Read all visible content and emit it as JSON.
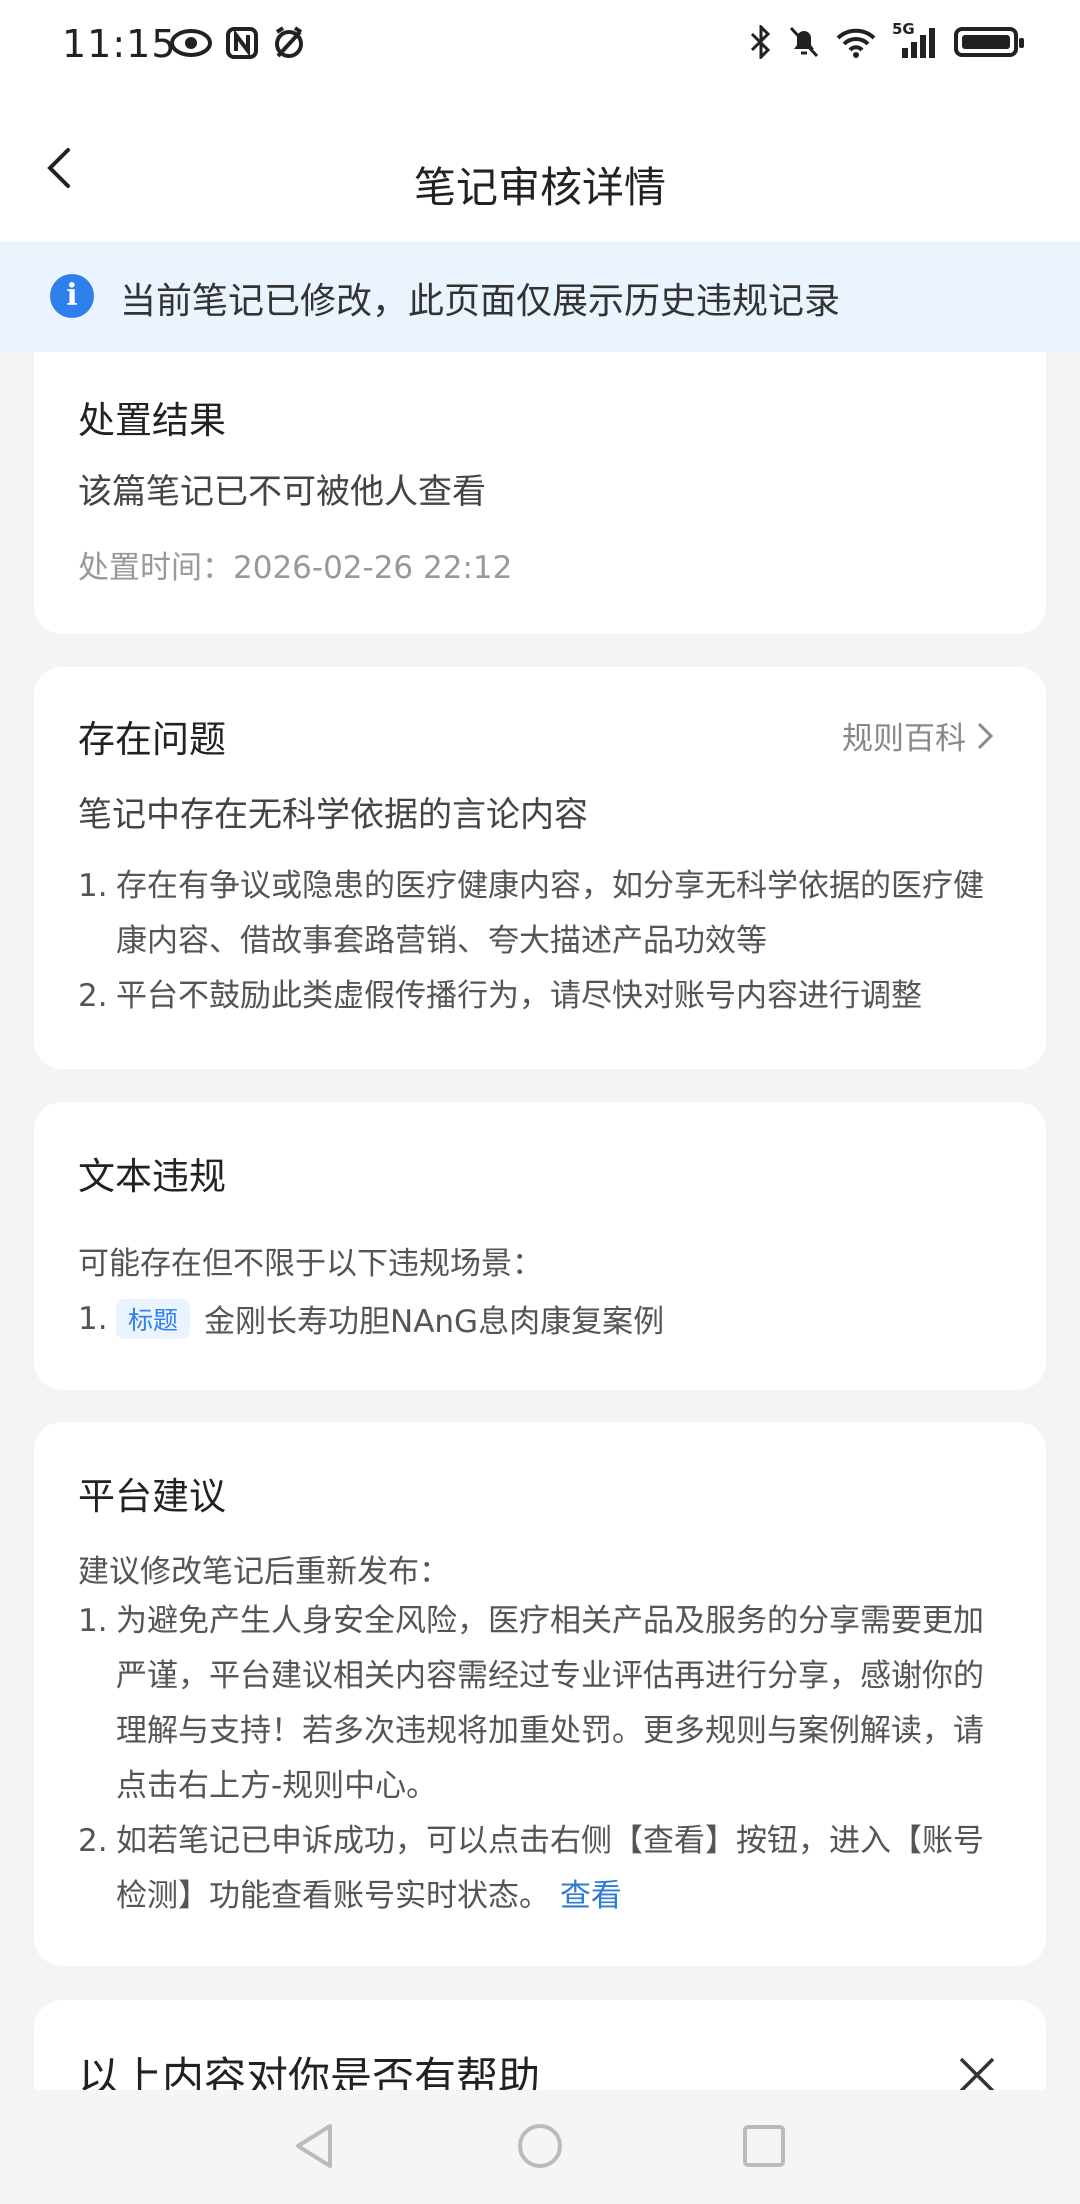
{
  "status": {
    "time": "11:15",
    "network": "5G"
  },
  "header": {
    "title": "笔记审核详情"
  },
  "notice": {
    "text": "当前笔记已修改，此页面仅展示历史违规记录"
  },
  "result": {
    "title": "处置结果",
    "desc": "该篇笔记已不可被他人查看",
    "time": "处置时间：2026-02-26 22:12"
  },
  "issues": {
    "title": "存在问题",
    "link_label": "规则百科",
    "summary": "笔记中存在无科学依据的言论内容",
    "items": [
      {
        "num": "1.",
        "text": "存在有争议或隐患的医疗健康内容，如分享无科学依据的医疗健康内容、借故事套路营销、夸大描述产品功效等"
      },
      {
        "num": "2.",
        "text": "平台不鼓励此类虚假传播行为，请尽快对账号内容进行调整"
      }
    ]
  },
  "violation": {
    "title": "文本违规",
    "intro": "可能存在但不限于以下违规场景：",
    "items": [
      {
        "num": "1.",
        "tag": "标题",
        "text": "金刚长寿功胆NAnG息肉康复案例"
      }
    ]
  },
  "advice": {
    "title": "平台建议",
    "intro": "建议修改笔记后重新发布：",
    "items": [
      {
        "num": "1.",
        "text": "为避免产生人身安全风险，医疗相关产品及服务的分享需要更加严谨，平台建议相关内容需经过专业评估再进行分享，感谢你的理解与支持！若多次违规将加重处罚。更多规则与案例解读，请点击右上方-规则中心。"
      },
      {
        "num": "2.",
        "text": "如若笔记已申诉成功，可以点击右侧【查看】按钮，进入【账号检测】功能查看账号实时状态。",
        "link": "查看"
      }
    ]
  },
  "feedback": {
    "title": "以上内容对你是否有帮助"
  },
  "colors": {
    "accent": "#2f80ed",
    "notice_bg": "#eaf4ff",
    "page_bg": "#f4f4f6"
  }
}
